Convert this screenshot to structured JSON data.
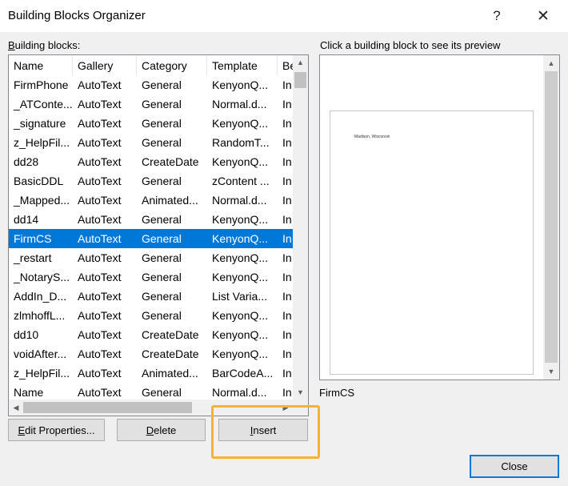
{
  "window": {
    "title": "Building Blocks Organizer",
    "help": "?",
    "close": "✕"
  },
  "list_label": {
    "accel": "B",
    "rest": "uilding blocks:"
  },
  "preview_label": "Click a building block to see its preview",
  "columns": [
    "Name",
    "Gallery",
    "Category",
    "Template",
    "Be"
  ],
  "rows": [
    [
      "FirmPhone",
      "AutoText",
      "General",
      "KenyonQ...",
      "In"
    ],
    [
      "_ATConte...",
      "AutoText",
      "General",
      "Normal.d...",
      "In"
    ],
    [
      "_signature",
      "AutoText",
      "General",
      "KenyonQ...",
      "In"
    ],
    [
      "z_HelpFil...",
      "AutoText",
      "General",
      "RandomT...",
      "In"
    ],
    [
      "dd28",
      "AutoText",
      "CreateDate",
      "KenyonQ...",
      "In"
    ],
    [
      "BasicDDL",
      "AutoText",
      "General",
      "zContent ...",
      "In"
    ],
    [
      "_Mapped...",
      "AutoText",
      "Animated...",
      "Normal.d...",
      "In"
    ],
    [
      "dd14",
      "AutoText",
      "General",
      "KenyonQ...",
      "In"
    ],
    [
      "FirmCS",
      "AutoText",
      "General",
      "KenyonQ...",
      "In"
    ],
    [
      "_restart",
      "AutoText",
      "General",
      "KenyonQ...",
      "In"
    ],
    [
      "_NotaryS...",
      "AutoText",
      "General",
      "KenyonQ...",
      "In"
    ],
    [
      "AddIn_D...",
      "AutoText",
      "General",
      "List Varia...",
      "In"
    ],
    [
      "zlmhoffL...",
      "AutoText",
      "General",
      "KenyonQ...",
      "In"
    ],
    [
      "dd10",
      "AutoText",
      "CreateDate",
      "KenyonQ...",
      "In"
    ],
    [
      "voidAfter...",
      "AutoText",
      "CreateDate",
      "KenyonQ...",
      "In"
    ],
    [
      "z_HelpFil...",
      "AutoText",
      "Animated...",
      "BarCodeA...",
      "In"
    ],
    [
      "Name",
      "AutoText",
      "General",
      "Normal.d...",
      "In"
    ]
  ],
  "selected_index": 8,
  "preview_text": "Madison, Wisconsin",
  "preview_caption": "FirmCS",
  "buttons": {
    "edit": {
      "accel": "E",
      "rest": "dit Properties..."
    },
    "delete": {
      "accel": "D",
      "rest": "elete"
    },
    "insert": {
      "accel": "I",
      "rest": "nsert"
    },
    "close": "Close"
  },
  "colors": {
    "selection": "#0078d7",
    "highlight": "#f5b335"
  }
}
